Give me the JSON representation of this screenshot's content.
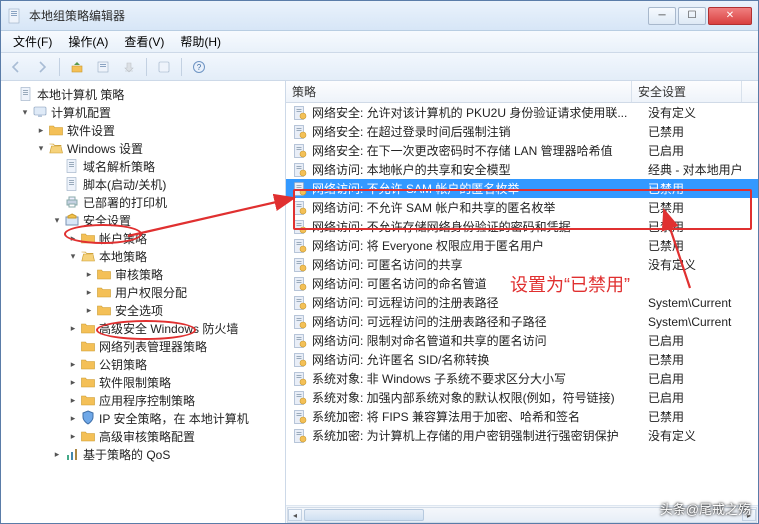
{
  "window": {
    "title": "本地组策略编辑器"
  },
  "menubar": [
    "文件(F)",
    "操作(A)",
    "查看(V)",
    "帮助(H)"
  ],
  "tree": [
    {
      "indent": 0,
      "twist": "",
      "icon": "doc",
      "label": "本地计算机 策略"
    },
    {
      "indent": 1,
      "twist": "▾",
      "icon": "pc",
      "label": "计算机配置"
    },
    {
      "indent": 2,
      "twist": "▸",
      "icon": "folder",
      "label": "软件设置"
    },
    {
      "indent": 2,
      "twist": "▾",
      "icon": "folder-open",
      "label": "Windows 设置"
    },
    {
      "indent": 3,
      "twist": "",
      "icon": "doc",
      "label": "域名解析策略"
    },
    {
      "indent": 3,
      "twist": "",
      "icon": "doc",
      "label": "脚本(启动/关机)"
    },
    {
      "indent": 3,
      "twist": "",
      "icon": "printer",
      "label": "已部署的打印机"
    },
    {
      "indent": 3,
      "twist": "▾",
      "icon": "security",
      "label": "安全设置"
    },
    {
      "indent": 4,
      "twist": "▸",
      "icon": "folder",
      "label": "帐户策略"
    },
    {
      "indent": 4,
      "twist": "▾",
      "icon": "folder-open",
      "label": "本地策略"
    },
    {
      "indent": 5,
      "twist": "▸",
      "icon": "folder",
      "label": "审核策略"
    },
    {
      "indent": 5,
      "twist": "▸",
      "icon": "folder",
      "label": "用户权限分配"
    },
    {
      "indent": 5,
      "twist": "▸",
      "icon": "folder",
      "label": "安全选项"
    },
    {
      "indent": 4,
      "twist": "▸",
      "icon": "folder",
      "label": "高级安全 Windows 防火墙"
    },
    {
      "indent": 4,
      "twist": "",
      "icon": "folder",
      "label": "网络列表管理器策略"
    },
    {
      "indent": 4,
      "twist": "▸",
      "icon": "folder",
      "label": "公钥策略"
    },
    {
      "indent": 4,
      "twist": "▸",
      "icon": "folder",
      "label": "软件限制策略"
    },
    {
      "indent": 4,
      "twist": "▸",
      "icon": "folder",
      "label": "应用程序控制策略"
    },
    {
      "indent": 4,
      "twist": "▸",
      "icon": "shield",
      "label": "IP 安全策略，在 本地计算机"
    },
    {
      "indent": 4,
      "twist": "▸",
      "icon": "folder",
      "label": "高级审核策略配置"
    },
    {
      "indent": 3,
      "twist": "▸",
      "icon": "bars",
      "label": "基于策略的 QoS"
    }
  ],
  "list": {
    "headers": {
      "policy": "策略",
      "setting": "安全设置"
    },
    "rows": [
      {
        "name": "网络安全: 允许对该计算机的 PKU2U 身份验证请求使用联...",
        "value": "没有定义",
        "sel": false
      },
      {
        "name": "网络安全: 在超过登录时间后强制注销",
        "value": "已禁用",
        "sel": false
      },
      {
        "name": "网络安全: 在下一次更改密码时不存储 LAN 管理器哈希值",
        "value": "已启用",
        "sel": false
      },
      {
        "name": "网络访问: 本地帐户的共享和安全模型",
        "value": "经典 - 对本地用户",
        "sel": false
      },
      {
        "name": "网络访问: 不允许 SAM 帐户的匿名枚举",
        "value": "已禁用",
        "sel": true
      },
      {
        "name": "网络访问: 不允许 SAM 帐户和共享的匿名枚举",
        "value": "已禁用",
        "sel": false
      },
      {
        "name": "网络访问: 不允许存储网络身份验证的密码和凭据",
        "value": "已禁用",
        "sel": false
      },
      {
        "name": "网络访问: 将 Everyone 权限应用于匿名用户",
        "value": "已禁用",
        "sel": false
      },
      {
        "name": "网络访问: 可匿名访问的共享",
        "value": "没有定义",
        "sel": false
      },
      {
        "name": "网络访问: 可匿名访问的命名管道",
        "value": "",
        "sel": false
      },
      {
        "name": "网络访问: 可远程访问的注册表路径",
        "value": "System\\Current",
        "sel": false
      },
      {
        "name": "网络访问: 可远程访问的注册表路径和子路径",
        "value": "System\\Current",
        "sel": false
      },
      {
        "name": "网络访问: 限制对命名管道和共享的匿名访问",
        "value": "已启用",
        "sel": false
      },
      {
        "name": "网络访问: 允许匿名 SID/名称转换",
        "value": "已禁用",
        "sel": false
      },
      {
        "name": "系统对象: 非 Windows 子系统不要求区分大小写",
        "value": "已启用",
        "sel": false
      },
      {
        "name": "系统对象: 加强内部系统对象的默认权限(例如，符号链接)",
        "value": "已启用",
        "sel": false
      },
      {
        "name": "系统加密: 将 FIPS 兼容算法用于加密、哈希和签名",
        "value": "已禁用",
        "sel": false
      },
      {
        "name": "系统加密: 为计算机上存储的用户密钥强制进行强密钥保护",
        "value": "没有定义",
        "sel": false
      }
    ]
  },
  "annotations": {
    "note": "设置为“已禁用”"
  },
  "watermark": "头条@尾戒之殇"
}
